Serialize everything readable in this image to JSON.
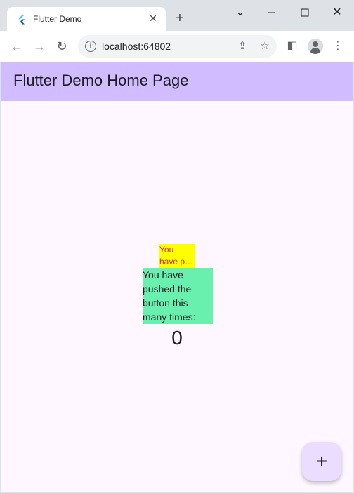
{
  "browser": {
    "tab": {
      "title": "Flutter Demo",
      "close_glyph": "✕"
    },
    "new_tab_glyph": "+",
    "window_controls": {
      "minimize": "⌄",
      "maximize": "☐",
      "close": "✕"
    },
    "toolbar": {
      "back_glyph": "←",
      "forward_glyph": "→",
      "reload_glyph": "↻",
      "url": "localhost:64802",
      "share_glyph": "⇪",
      "star_glyph": "☆",
      "side_panel_glyph": "◧",
      "menu_glyph": "⋮"
    }
  },
  "app": {
    "title": "Flutter Demo Home Page",
    "small_text_line1": "You",
    "small_text_line2": "have pushed the button this many times:",
    "big_text": "You have pushed the button this many times:",
    "counter": "0",
    "fab_glyph": "+",
    "colors": {
      "appbar": "#d0bcff",
      "background": "#fef7ff",
      "small_box": "#ffff00",
      "small_text": "#d32f2f",
      "big_box": "#69f0ae",
      "fab": "#eaddff"
    }
  }
}
